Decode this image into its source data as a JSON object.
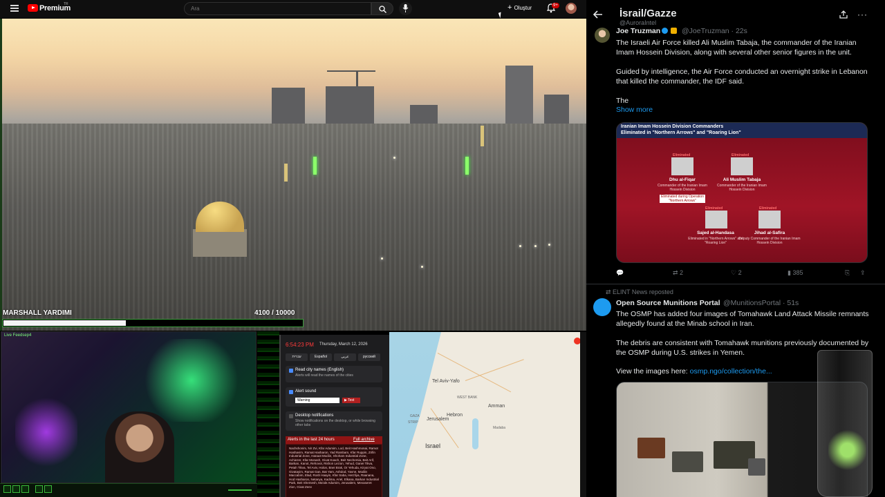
{
  "youtube": {
    "brand": "Premium",
    "brand_tag": "TR",
    "search_placeholder": "Ara",
    "create_label": "Oluştur",
    "notif_badge": "9+"
  },
  "stream_overlay": {
    "label": "MARSHALL YARDIMI",
    "current": "4100",
    "goal": "/ 10000",
    "progress": 0.41
  },
  "webcam": {
    "title": "Live Feedsep4"
  },
  "alerts_panel": {
    "time": "6:54:23 PM",
    "date": "Thursday, March 12, 2026",
    "languages": [
      "עברית",
      "Español",
      "عربي",
      "русский"
    ],
    "read_city_label": "Read city names (English)",
    "read_city_sub": "Alerts will read the names of the cities",
    "alert_sound_label": "Alert sound",
    "sound_option": "Warning",
    "test_label": "▶ Test",
    "desktop_notif_label": "Desktop notifications",
    "desktop_notif_sub": "Show notifications on the desktop, or while browsing other tabs",
    "last24_label": "Alerts in the last 24 hours",
    "archive_label": "Full archive",
    "alert_text": "Nachshonim, Nir Zvi, Kfar Adumim, Lod, Beit Hashmonai, Ramot Hashavim, Ramat Hasharon, Yad Rambam, Kfar Ruppin, Zrifin Industrial Zone, Hanaot Modiin, Shoham Industrial Zone, Achiezer, Kfar Monash, Givat Koach, Beit Nechemia, Beit Arif, Barkan, Kanot, Rehovot, Rishon Lezion, Yehud, Ganei Tikva, Petah Tikva, Tel Aviv, Holon, Bnei Brak, Or Yehuda, Kiryat Ono, Givatayim, Ramat Gan, Bat Yam, Ashdod, Yavne, Modiin Maccabim, Elad, Rosh Haayin, Kfar Saba, Herzliya, Raanana, Hod Hasharon, Netanya, Kadima, Ariel, Elkana, Barkan Industrial Park, Beit Shemesh, Ma'ale Adumim, Jerusalem, Mevaseret Zion, Givat Zeev"
  },
  "map": {
    "labels": {
      "tel_aviv": "Tel Aviv-Yafo",
      "west_bank": "WEST BANK",
      "amman": "Amman",
      "jerusalem": "Jerusalem",
      "gaza": "GAZA",
      "strip": "STRIP",
      "hebron": "Hebron",
      "israel": "Israel",
      "jordan_town": "Madaba"
    }
  },
  "x": {
    "header_title": "İsrail/Gazze",
    "header_handle": "@AuroraIntel",
    "post1": {
      "name": "Joe Truzman",
      "handle": "@JoeTruzman · 22s",
      "para1": "The Israeli Air Force killed Ali Muslim Tabaja, the commander of the Iranian Imam Hossein Division, along with several other senior figures in the unit.",
      "para2": "Guided by intelligence, the Air Force conducted an overnight strike in Lebanon that killed the commander, the IDF said.",
      "para3": "The",
      "show_more": "Show more",
      "card": {
        "title1": "Iranian Imam Hossein Division Commanders",
        "title2": "Eliminated in \"Northern Arrows\" and \"Roaring Lion\"",
        "eliminated": "Eliminated",
        "n1_name": "Dhu al-Fiqar",
        "n1_role": "Commander of the Iranian Imam Hossein Division",
        "n1_note": "Eliminated during Operation \"Northern Arrows\"",
        "n2_name": "Ali Muslim Tabaja",
        "n2_role": "Commander of the Iranian Imam Hossein Division",
        "n3_name": "Sajed al-Handasa",
        "n3_role": "Eliminated in \"Northern Arrows\" and \"Roaring Lion\"",
        "n4_name": "Jihad al-Safira",
        "n4_role": "Deputy Commander of the Iranian Imam Hossein Division"
      },
      "reposts": "2",
      "likes": "2",
      "views": "385"
    },
    "post2": {
      "repost_label": "ELINT News reposted",
      "name": "Open Source Munitions Portal",
      "handle": "@MunitionsPortal · 51s",
      "para1": "The OSMP has added four images of Tomahawk Land Attack Missile remnants allegedly found at the Minab school in Iran.",
      "para2": "The debris are consistent with Tomahawk munitions previously documented by the OSMP during U.S. strikes in Yemen.",
      "para3_prefix": "View the images here: ",
      "para3_link": "osmp.ngo/collection/the..."
    }
  }
}
